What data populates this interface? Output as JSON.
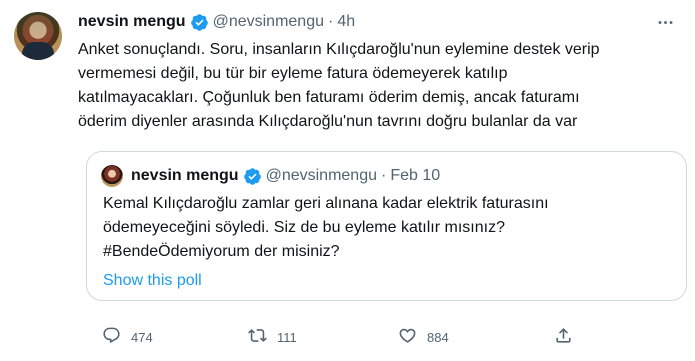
{
  "tweet": {
    "author_name": "nevsin mengu",
    "handle": "@nevsinmengu",
    "separator": "·",
    "time": "4h",
    "text_lines": [
      "Anket sonuçlandı. Soru, insanların Kılıçdaroğlu'nun eylemine destek verip",
      "vermemesi değil, bu tür bir eyleme fatura ödemeyerek katılıp",
      "katılmayacakları. Çoğunluk ben faturamı öderim demiş, ancak faturamı",
      "öderim diyenler arasında Kılıçdaroğlu'nun tavrını doğru bulanlar da var"
    ]
  },
  "quoted_tweet": {
    "author_name": "nevsin mengu",
    "handle": "@nevsinmengu",
    "separator": "·",
    "time": "Feb 10",
    "text_lines": [
      "Kemal Kılıçdaroğlu zamlar geri alınana kadar elektrik faturasını",
      "ödemeyeceğini söyledi. Siz de bu eyleme katılır mısınız?",
      "#BendeÖdemiyorum der misiniz?"
    ],
    "poll_link_label": "Show this poll"
  },
  "actions": {
    "reply_count": "474",
    "retweet_count": "111",
    "like_count": "884"
  },
  "colors": {
    "accent": "#1d9bf0",
    "secondary_text": "#536471",
    "border": "#cfd9de"
  }
}
